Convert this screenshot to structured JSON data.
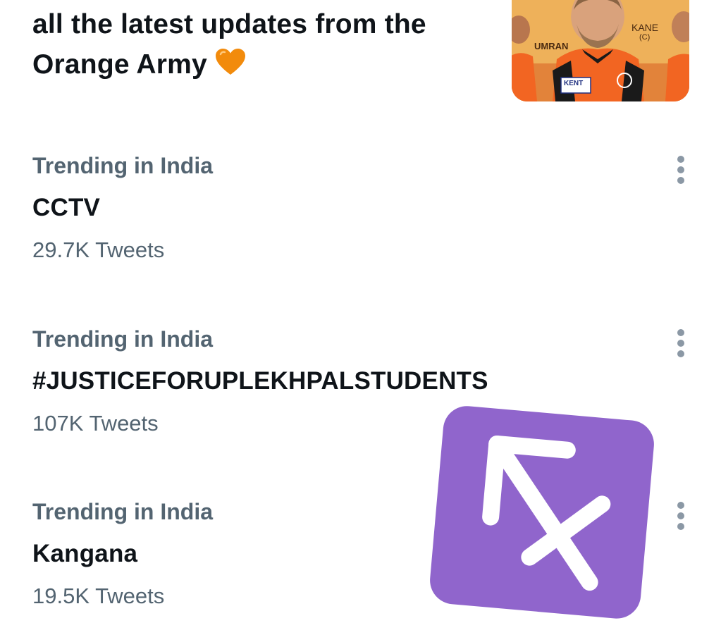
{
  "promo": {
    "line1": "all the latest updates from the",
    "line2": "Orange Army",
    "image_labels": {
      "left_player": "UMRAN",
      "center_player": "KANE",
      "captain_mark": "(C)",
      "jersey_sponsor": "KENT"
    }
  },
  "trends": [
    {
      "context": "Trending in India",
      "title": "CCTV",
      "count": "29.7K Tweets"
    },
    {
      "context": "Trending in India",
      "title": "#JUSTICEFORUPLEKHPALSTUDENTS",
      "count": "107K Tweets"
    },
    {
      "context": "Trending in India",
      "title": "Kangana",
      "count": "19.5K Tweets"
    }
  ],
  "icons": {
    "heart": "orange-heart-icon",
    "more": "more-options-icon",
    "sticker": "sagittarius-icon"
  },
  "colors": {
    "primary_text": "#0f1419",
    "secondary_text": "#536471",
    "heart": "#f28b0c",
    "sticker": "#9065cc",
    "jersey": "#f26522"
  }
}
